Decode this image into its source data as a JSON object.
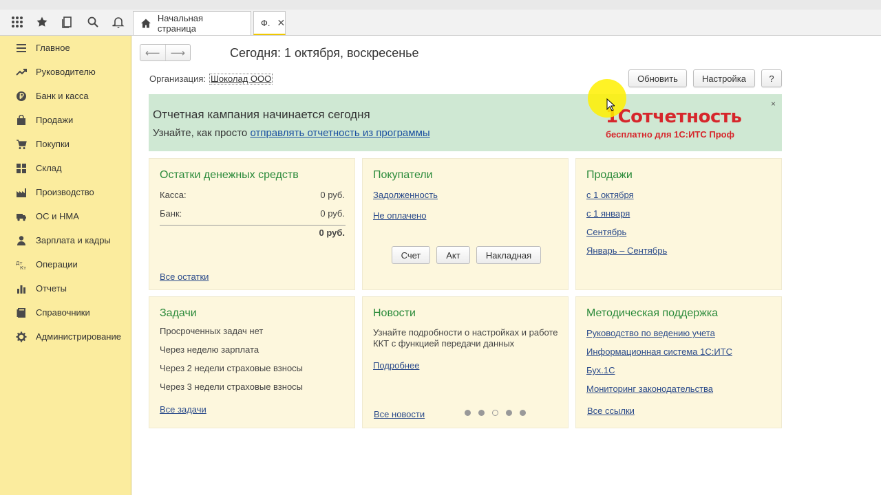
{
  "tabs": [
    {
      "label": "Начальная страница"
    },
    {
      "label": "Ф."
    }
  ],
  "sidebar": {
    "items": [
      {
        "label": "Главное",
        "icon": "menu-icon"
      },
      {
        "label": "Руководителю",
        "icon": "trend-icon"
      },
      {
        "label": "Банк и касса",
        "icon": "ruble-icon"
      },
      {
        "label": "Продажи",
        "icon": "bag-icon"
      },
      {
        "label": "Покупки",
        "icon": "cart-icon"
      },
      {
        "label": "Склад",
        "icon": "grid-icon"
      },
      {
        "label": "Производство",
        "icon": "factory-icon"
      },
      {
        "label": "ОС и НМА",
        "icon": "truck-icon"
      },
      {
        "label": "Зарплата и кадры",
        "icon": "person-icon"
      },
      {
        "label": "Операции",
        "icon": "dtkt-icon"
      },
      {
        "label": "Отчеты",
        "icon": "bar-chart-icon"
      },
      {
        "label": "Справочники",
        "icon": "book-icon"
      },
      {
        "label": "Администрирование",
        "icon": "gear-icon"
      }
    ]
  },
  "header": {
    "title": "Сегодня: 1 октября, воскресенье",
    "org_label": "Организация:",
    "org_value": "Шоколад ООО",
    "refresh_label": "Обновить",
    "settings_label": "Настройка",
    "help_label": "?"
  },
  "banner": {
    "title": "Отчетная кампания начинается сегодня",
    "text_prefix": "Узнайте, как просто ",
    "link": "отправлять отчетность из программы",
    "logo_main": "1Сотчетность",
    "logo_sub": "бесплатно для 1С:ИТС Проф",
    "close": "×"
  },
  "cash": {
    "title": "Остатки денежных средств",
    "rows": [
      {
        "label": "Касса:",
        "value": "0 руб."
      },
      {
        "label": "Банк:",
        "value": "0 руб."
      }
    ],
    "total": "0 руб.",
    "link": "Все остатки"
  },
  "buyers": {
    "title": "Покупатели",
    "links": [
      "Задолженность",
      "Не оплачено"
    ],
    "buttons": [
      "Счет",
      "Акт",
      "Накладная"
    ]
  },
  "sales": {
    "title": "Продажи",
    "links": [
      "с 1 октября",
      "с 1 января",
      "Сентябрь",
      "Январь – Сентябрь"
    ]
  },
  "tasks": {
    "title": "Задачи",
    "items": [
      "Просроченных задач нет",
      "Через неделю зарплата",
      "Через 2 недели страховые взносы",
      "Через 3 недели страховые взносы"
    ],
    "link": "Все задачи"
  },
  "news": {
    "title": "Новости",
    "text_line1": "Узнайте подробности о настройках и работе",
    "text_line2": "ККТ с функцией передачи данных",
    "more": "Подробнее",
    "all": "Все новости"
  },
  "support": {
    "title": "Методическая поддержка",
    "links": [
      "Руководство по ведению учета",
      "Информационная система 1С:ИТС",
      "Бух.1С",
      "Мониторинг законодательства"
    ],
    "all": "Все ссылки"
  },
  "colors": {
    "sidebar_bg": "#fbec9e",
    "panel_bg": "#fdf7dd",
    "banner_bg": "#cfe8d3",
    "title_green": "#2a8a3a",
    "brand_red": "#d6262b"
  }
}
